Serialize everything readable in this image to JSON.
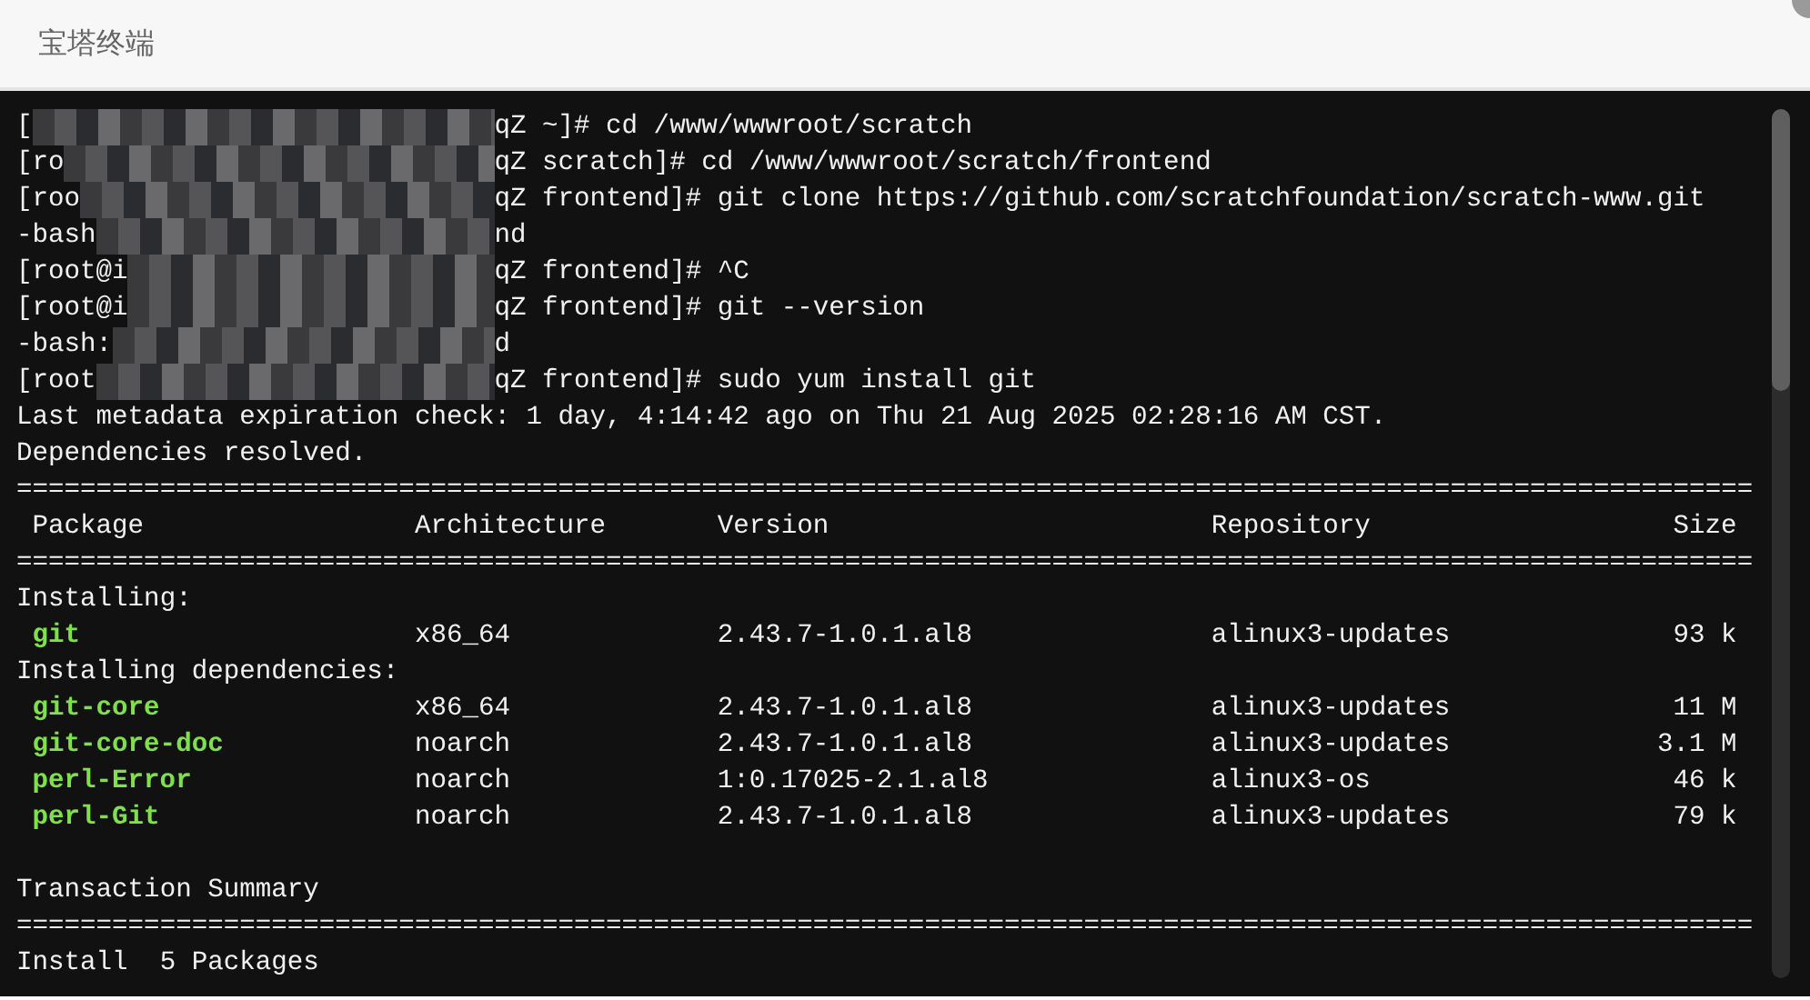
{
  "window": {
    "title": "宝塔终端"
  },
  "terminal": {
    "lines": [
      {
        "kind": "redacted",
        "before": "[",
        "after": "qZ ~]# cd /www/wwwroot/scratch"
      },
      {
        "kind": "redacted",
        "before": "[ro",
        "after": "qZ scratch]# cd /www/wwwroot/scratch/frontend"
      },
      {
        "kind": "redacted",
        "before": "[roo",
        "after": "qZ frontend]# git clone https://github.com/scratchfoundation/scratch-www.git"
      },
      {
        "kind": "redacted",
        "before": "-bash",
        "after": "nd"
      },
      {
        "kind": "redacted",
        "before": "[root@i",
        "after": "qZ frontend]# ^C"
      },
      {
        "kind": "redacted",
        "before": "[root@i",
        "after": "qZ frontend]# git --version"
      },
      {
        "kind": "redacted",
        "before": "-bash:",
        "after": "d"
      },
      {
        "kind": "redacted",
        "before": "[root",
        "after": "qZ frontend]# sudo yum install git"
      },
      {
        "kind": "text",
        "text": "Last metadata expiration check: 1 day, 4:14:42 ago on Thu 21 Aug 2025 02:28:16 AM CST."
      },
      {
        "kind": "text",
        "text": "Dependencies resolved."
      },
      {
        "kind": "rule",
        "text": "============================================================================================================="
      },
      {
        "kind": "header",
        "columns": [
          "Package",
          "Architecture",
          "Version",
          "Repository",
          "Size"
        ]
      },
      {
        "kind": "rule",
        "text": "============================================================================================================="
      },
      {
        "kind": "text",
        "text": "Installing:"
      },
      {
        "kind": "package",
        "name": "git",
        "arch": "x86_64",
        "version": "2.43.7-1.0.1.al8",
        "repo": "alinux3-updates",
        "size": "93 k"
      },
      {
        "kind": "text",
        "text": "Installing dependencies:"
      },
      {
        "kind": "package",
        "name": "git-core",
        "arch": "x86_64",
        "version": "2.43.7-1.0.1.al8",
        "repo": "alinux3-updates",
        "size": "11 M"
      },
      {
        "kind": "package",
        "name": "git-core-doc",
        "arch": "noarch",
        "version": "2.43.7-1.0.1.al8",
        "repo": "alinux3-updates",
        "size": "3.1 M"
      },
      {
        "kind": "package",
        "name": "perl-Error",
        "arch": "noarch",
        "version": "1:0.17025-2.1.al8",
        "repo": "alinux3-os",
        "size": "46 k"
      },
      {
        "kind": "package",
        "name": "perl-Git",
        "arch": "noarch",
        "version": "2.43.7-1.0.1.al8",
        "repo": "alinux3-updates",
        "size": "79 k"
      },
      {
        "kind": "blank"
      },
      {
        "kind": "text",
        "text": "Transaction Summary"
      },
      {
        "kind": "rule",
        "text": "============================================================================================================="
      },
      {
        "kind": "text",
        "text": "Install  5 Packages"
      }
    ]
  }
}
